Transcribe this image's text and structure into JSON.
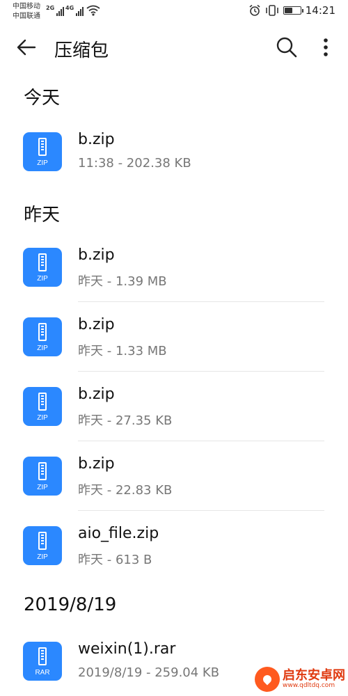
{
  "status_bar": {
    "carrier_1": "中国移动",
    "carrier_2": "中国联通",
    "net_1": "2G",
    "net_2": "4G",
    "time": "14:21",
    "battery_level": 0.55
  },
  "app_bar": {
    "title": "压缩包"
  },
  "sections": [
    {
      "header": "今天",
      "items": [
        {
          "name": "b.zip",
          "meta": "11:38 - 202.38 KB",
          "ext": "ZIP"
        }
      ]
    },
    {
      "header": "昨天",
      "items": [
        {
          "name": "b.zip",
          "meta": "昨天 - 1.39 MB",
          "ext": "ZIP"
        },
        {
          "name": "b.zip",
          "meta": "昨天 - 1.33 MB",
          "ext": "ZIP"
        },
        {
          "name": "b.zip",
          "meta": "昨天 - 27.35 KB",
          "ext": "ZIP"
        },
        {
          "name": "b.zip",
          "meta": "昨天 - 22.83 KB",
          "ext": "ZIP"
        },
        {
          "name": "aio_file.zip",
          "meta": "昨天 - 613 B",
          "ext": "ZIP"
        }
      ]
    },
    {
      "header": "2019/8/19",
      "items": [
        {
          "name": "weixin(1).rar",
          "meta": "2019/8/19 - 259.04 KB",
          "ext": "RAR"
        }
      ]
    }
  ],
  "watermark": {
    "name": "启东安卓网",
    "url": "www.qdltdq.com"
  },
  "colors": {
    "icon_bg": "#2b88ff",
    "watermark": "#e03a10"
  }
}
